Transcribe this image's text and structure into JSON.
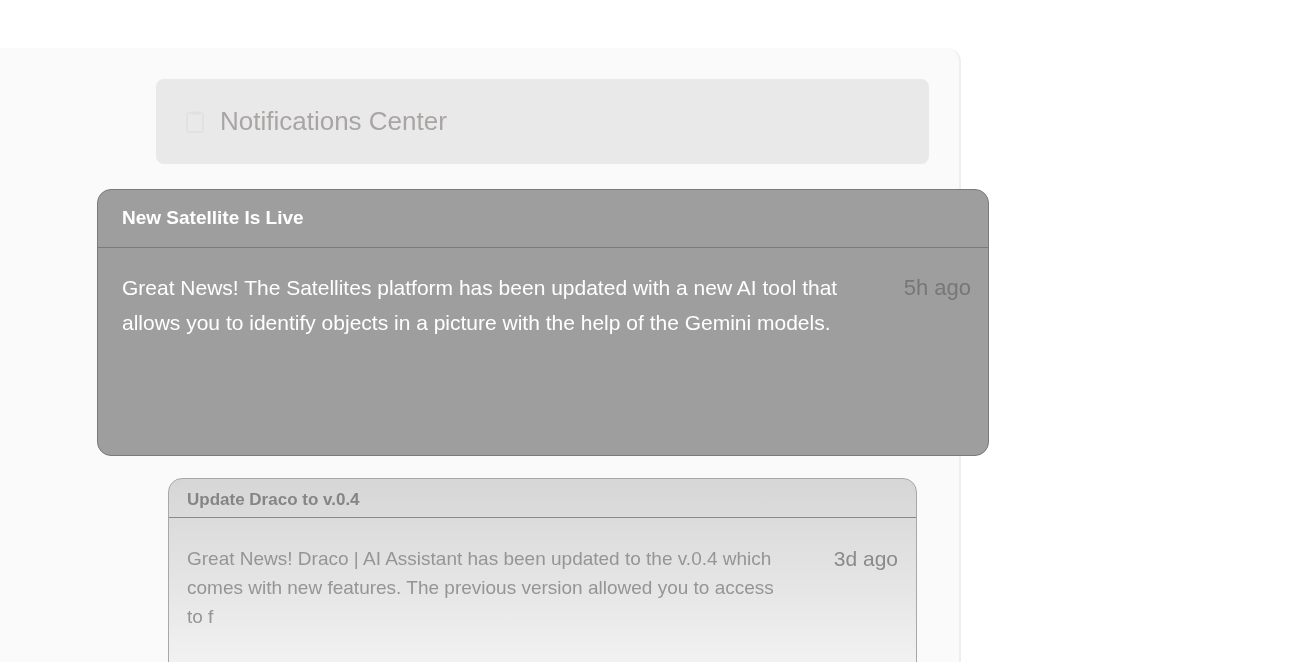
{
  "header": {
    "title": "Notifications Center"
  },
  "notifications": [
    {
      "title": "New Satellite Is Live",
      "message": "Great News! The Satellites platform has been updated with a new AI tool that allows you to identify objects in a picture with the help of the Gemini models.",
      "time": "5h ago",
      "selected": true
    },
    {
      "title": "Update Draco to v.0.4",
      "message": "Great News! Draco | AI Assistant has been updated to the v.0.4 which comes with new features. The previous version allowed you to access to f",
      "time": "3d ago",
      "selected": false
    }
  ]
}
